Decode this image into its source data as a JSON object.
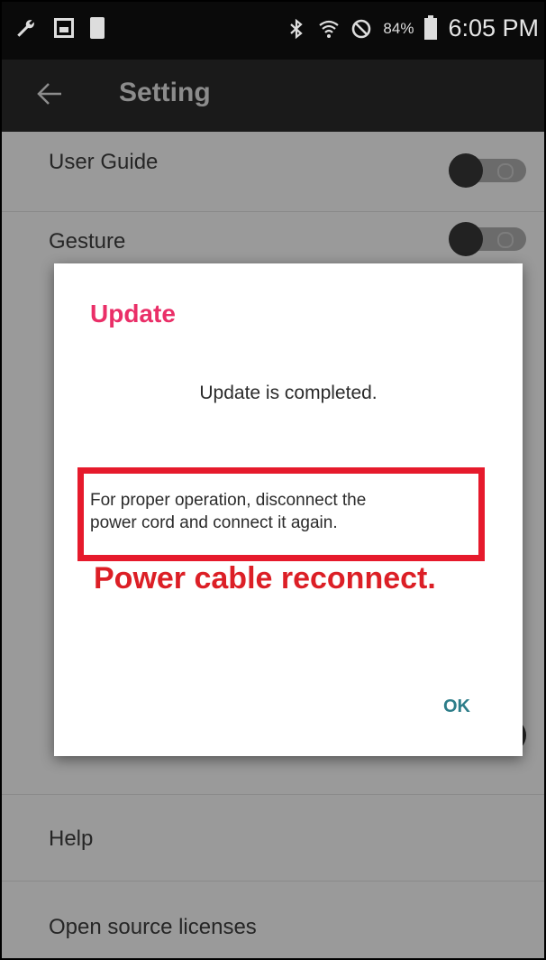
{
  "status_bar": {
    "icons": [
      "wrench-icon",
      "image-icon",
      "phone-icon",
      "bluetooth-icon",
      "wifi-icon",
      "do-not-disturb-icon",
      "battery-icon"
    ],
    "battery_percent": "84%",
    "time": "6:05 PM"
  },
  "toolbar": {
    "title": "Setting"
  },
  "settings": {
    "user_guide_label": "User Guide",
    "gesture_label": "Gesture",
    "help_label": "Help",
    "open_source_label": "Open source licenses"
  },
  "dialog": {
    "title": "Update",
    "message": "Update is completed.",
    "note_lines": [
      "For proper operation, disconnect the",
      "power cord and connect it again."
    ],
    "ok_label": "OK"
  },
  "annotation": {
    "text": "Power cable reconnect.",
    "color": "#dc1f26"
  },
  "colors": {
    "dialog_title": "#ea2f68",
    "ok_button": "#2d7d89",
    "highlight_border": "#e61a2c"
  }
}
